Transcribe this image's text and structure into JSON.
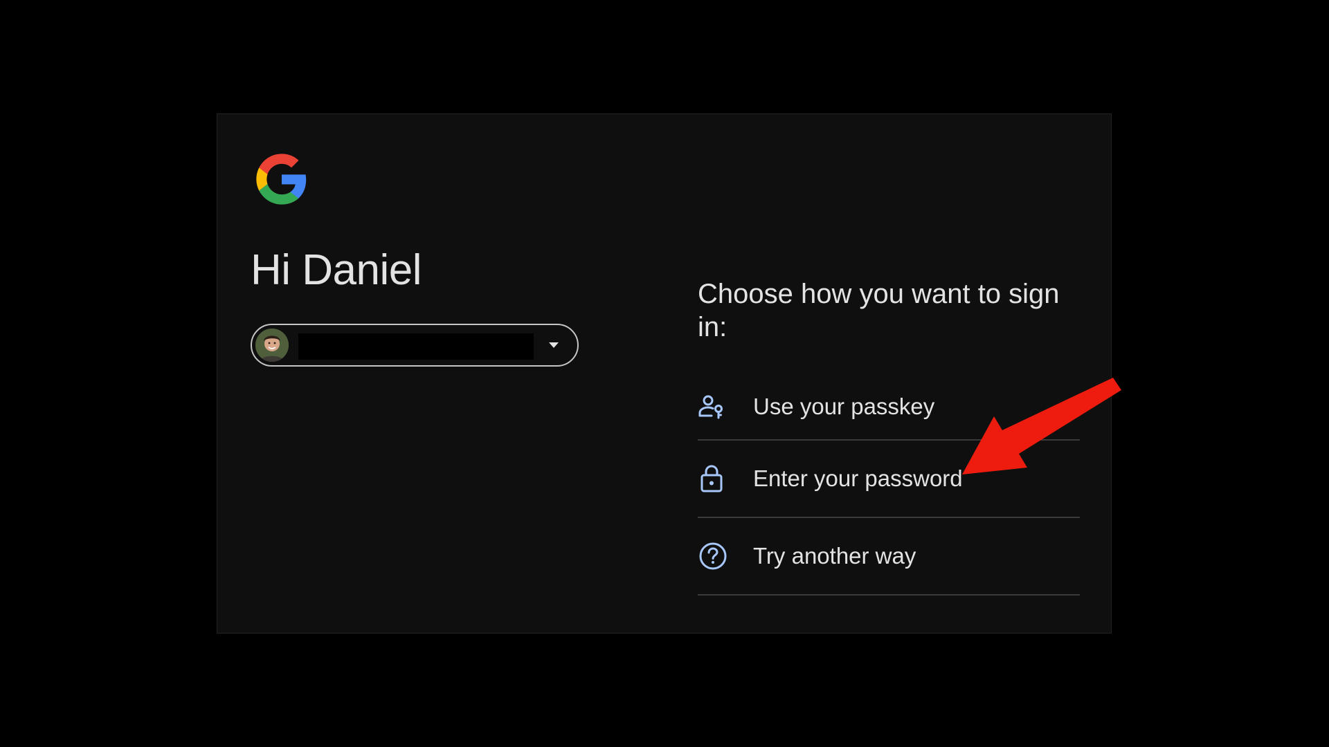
{
  "colors": {
    "background": "#000000",
    "card": "#0f0f0f",
    "text": "#e3e3e3",
    "icon_accent": "#a8c7fa",
    "divider": "#3a3a3a",
    "annotation_arrow": "#ee1c0e"
  },
  "header": {
    "logo_icon": "google-g-logo",
    "greeting": "Hi Daniel"
  },
  "account_chip": {
    "avatar_icon": "user-avatar",
    "email": "",
    "caret_icon": "caret-down-icon"
  },
  "main": {
    "prompt": "Choose how you want to sign in:",
    "options": [
      {
        "icon": "passkey-icon",
        "label": "Use your passkey"
      },
      {
        "icon": "lock-icon",
        "label": "Enter your password"
      },
      {
        "icon": "help-circle-icon",
        "label": "Try another way"
      }
    ]
  },
  "annotation": {
    "icon": "red-arrow-pointer",
    "points_to": "Enter your password"
  }
}
